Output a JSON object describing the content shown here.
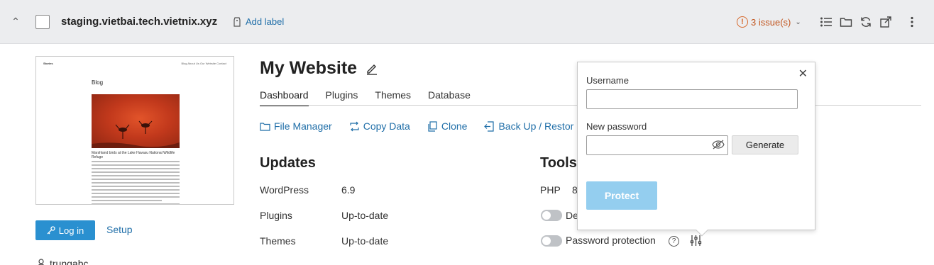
{
  "header": {
    "domain": "staging.vietbai.tech.vietnix.xyz",
    "add_label": "Add label",
    "issues": "3 issue(s)"
  },
  "preview": {
    "site_name": "Stories",
    "nav_links": "Blog  About Us  Our Website  Contact",
    "heading": "Blog",
    "caption": "Marshland birds at the Lake Havasu National Wildlife Refuge"
  },
  "sidebar": {
    "login_label": "Log in",
    "setup_label": "Setup",
    "user": "trungabc"
  },
  "main": {
    "title": "My Website",
    "tabs": [
      {
        "label": "Dashboard"
      },
      {
        "label": "Plugins"
      },
      {
        "label": "Themes"
      },
      {
        "label": "Database"
      }
    ],
    "actions": [
      {
        "label": "File Manager"
      },
      {
        "label": "Copy Data"
      },
      {
        "label": "Clone"
      },
      {
        "label": "Back Up / Restor"
      }
    ],
    "updates": {
      "title": "Updates",
      "rows": [
        {
          "label": "WordPress",
          "value": "6.9"
        },
        {
          "label": "Plugins",
          "value": "Up-to-date"
        },
        {
          "label": "Themes",
          "value": "Up-to-date"
        }
      ]
    },
    "tools": {
      "title": "Tools",
      "php_label": "PHP",
      "php_value": "8",
      "debug_label": "De",
      "password_label": "Password protection"
    }
  },
  "popup": {
    "username_label": "Username",
    "username_value": "",
    "password_label": "New password",
    "password_value": "",
    "generate_label": "Generate",
    "protect_label": "Protect"
  },
  "colors": {
    "accent": "#2a90d0",
    "link": "#1f6ea8",
    "warning": "#d6682b",
    "protect_disabled": "#94ceef"
  }
}
